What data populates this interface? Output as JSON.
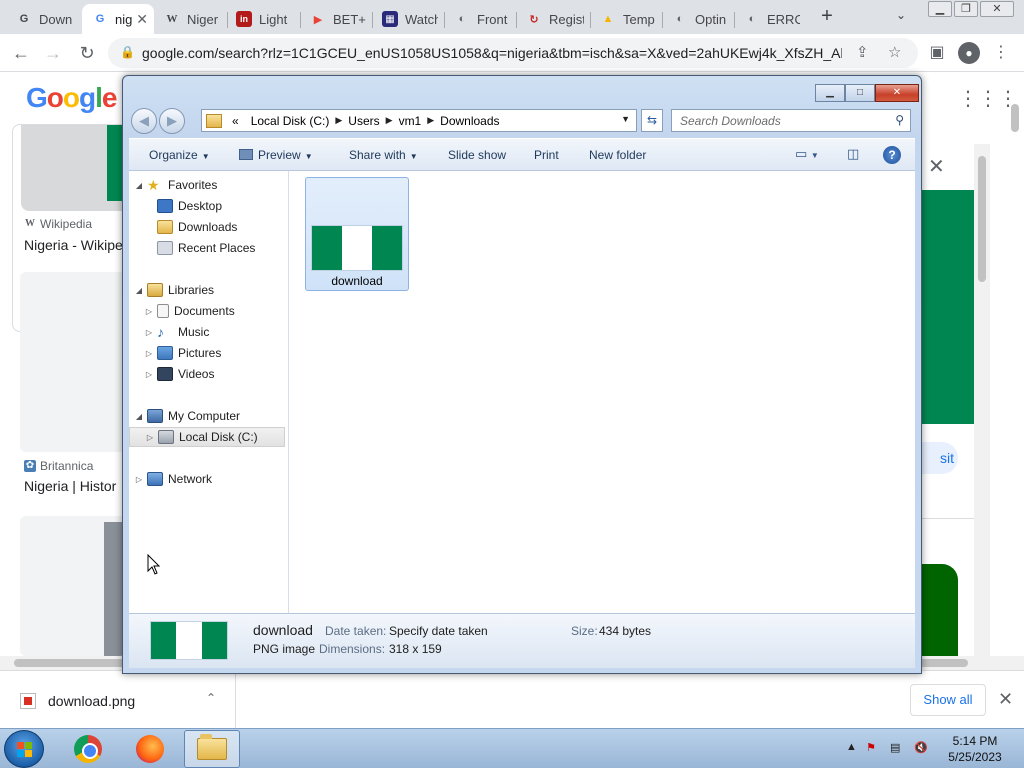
{
  "browser": {
    "tabs": [
      {
        "label": "Down",
        "fav": "G",
        "fav_color": "#5f6368",
        "fav_bg": "transparent"
      },
      {
        "label": "nig",
        "fav": "G",
        "fav_color": "#4285f4",
        "fav_bg": "transparent",
        "active": true
      },
      {
        "label": "Niger",
        "fav": "W",
        "fav_color": "#202124",
        "fav_bg": "transparent"
      },
      {
        "label": "Light",
        "fav": "in",
        "fav_color": "#ffffff",
        "fav_bg": "#b31b1b"
      },
      {
        "label": "BET+",
        "fav": "▶",
        "fav_color": "#ea4335",
        "fav_bg": "transparent"
      },
      {
        "label": "Watch",
        "fav": "▦",
        "fav_color": "#ffffff",
        "fav_bg": "#2a2a7a"
      },
      {
        "label": "Front",
        "fav": "◐",
        "fav_color": "#5f6368",
        "fav_bg": "transparent"
      },
      {
        "label": "Regist",
        "fav": "↻",
        "fav_color": "#c5221f",
        "fav_bg": "transparent"
      },
      {
        "label": "Temp",
        "fav": "▲",
        "fav_color": "#f4b400",
        "fav_bg": "transparent"
      },
      {
        "label": "Optin",
        "fav": "◐",
        "fav_color": "#5f6368",
        "fav_bg": "transparent"
      },
      {
        "label": "ERRO",
        "fav": "◐",
        "fav_color": "#5f6368",
        "fav_bg": "transparent"
      }
    ],
    "new_tab": "+",
    "url": "google.com/search?rlz=1C1GCEU_enUS1058US1058&q=nigeria&tbm=isch&sa=X&ved=2ahUKEwj4k_XfsZH_Ah..."
  },
  "google": {
    "logo": "Google",
    "results": [
      {
        "source": "Wikipedia",
        "title": "Nigeria - Wikipe"
      },
      {
        "source": "Britannica",
        "title": "Nigeria | Histor"
      }
    ],
    "visit": "sit"
  },
  "explorer": {
    "breadcrumb": {
      "prefix": "«",
      "parts": [
        "Local Disk (C:)",
        "Users",
        "vm1",
        "Downloads"
      ]
    },
    "search_placeholder": "Search Downloads",
    "commands": {
      "organize": "Organize",
      "preview": "Preview",
      "share_with": "Share with",
      "slide_show": "Slide show",
      "print": "Print",
      "new_folder": "New folder"
    },
    "nav": {
      "favorites": "Favorites",
      "desktop": "Desktop",
      "downloads": "Downloads",
      "recent_places": "Recent Places",
      "libraries": "Libraries",
      "documents": "Documents",
      "music": "Music",
      "pictures": "Pictures",
      "videos": "Videos",
      "my_computer": "My Computer",
      "local_disk": "Local Disk (C:)",
      "network": "Network"
    },
    "file": {
      "name": "download"
    },
    "details": {
      "name": "download",
      "type": "PNG image",
      "date_label": "Date taken:",
      "date_value": "Specify date taken",
      "dim_label": "Dimensions:",
      "dim_value": "318 x 159",
      "size_label": "Size:",
      "size_value": "434 bytes"
    },
    "flag_colors": {
      "green": "#008751",
      "white": "#ffffff"
    }
  },
  "downloads_bar": {
    "file": "download.png",
    "show_all": "Show all"
  },
  "taskbar": {
    "time": "5:14 PM",
    "date": "5/25/2023"
  }
}
